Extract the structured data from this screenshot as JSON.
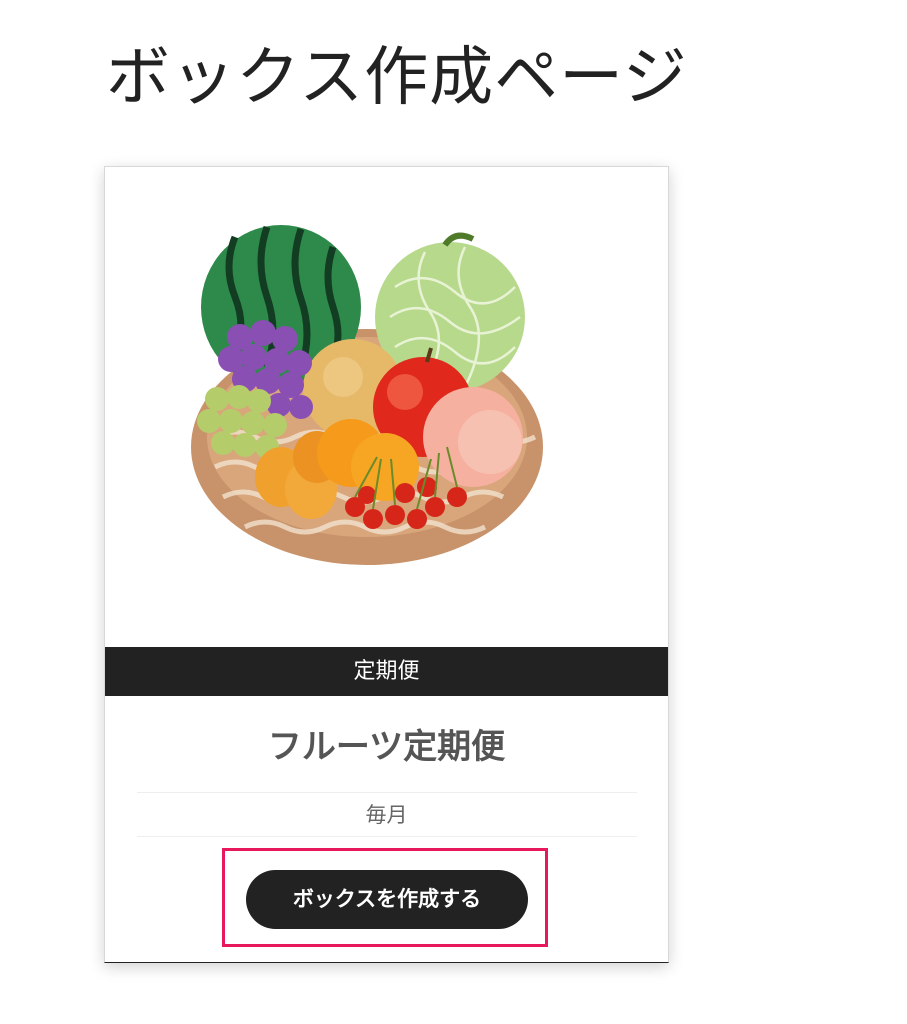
{
  "page": {
    "title": "ボックス作成ページ"
  },
  "card": {
    "image_name": "fruit-basket-illustration",
    "category": "定期便",
    "plan_name": "フルーツ定期便",
    "frequency": "毎月",
    "create_button_label": "ボックスを作成する"
  },
  "colors": {
    "category_bar": "#222222",
    "button": "#222222",
    "highlight_border": "#e8185c",
    "title_text": "#222222"
  }
}
